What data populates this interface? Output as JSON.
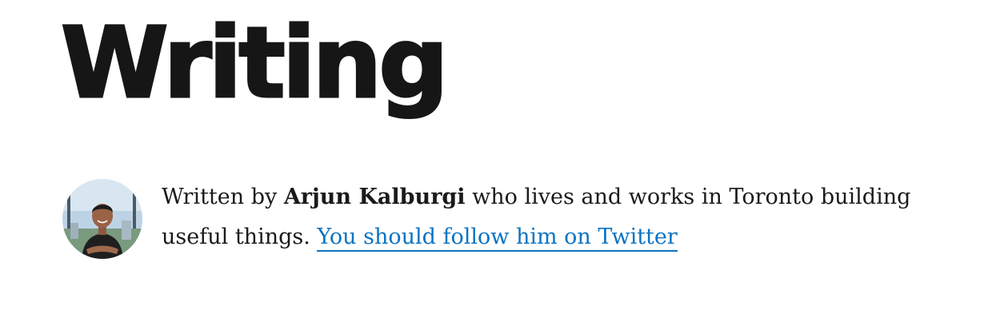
{
  "page": {
    "title": "Writing"
  },
  "bio": {
    "prefix": "Written by ",
    "author": "Arjun Kalburgi",
    "middle": " who lives and works in Toronto building useful things. ",
    "link_text": "You should follow him on Twitter",
    "avatar_icon": "author-photo"
  },
  "colors": {
    "title": "#161616",
    "text": "#1a1a1a",
    "link": "#0a73c2",
    "background": "#ffffff"
  }
}
